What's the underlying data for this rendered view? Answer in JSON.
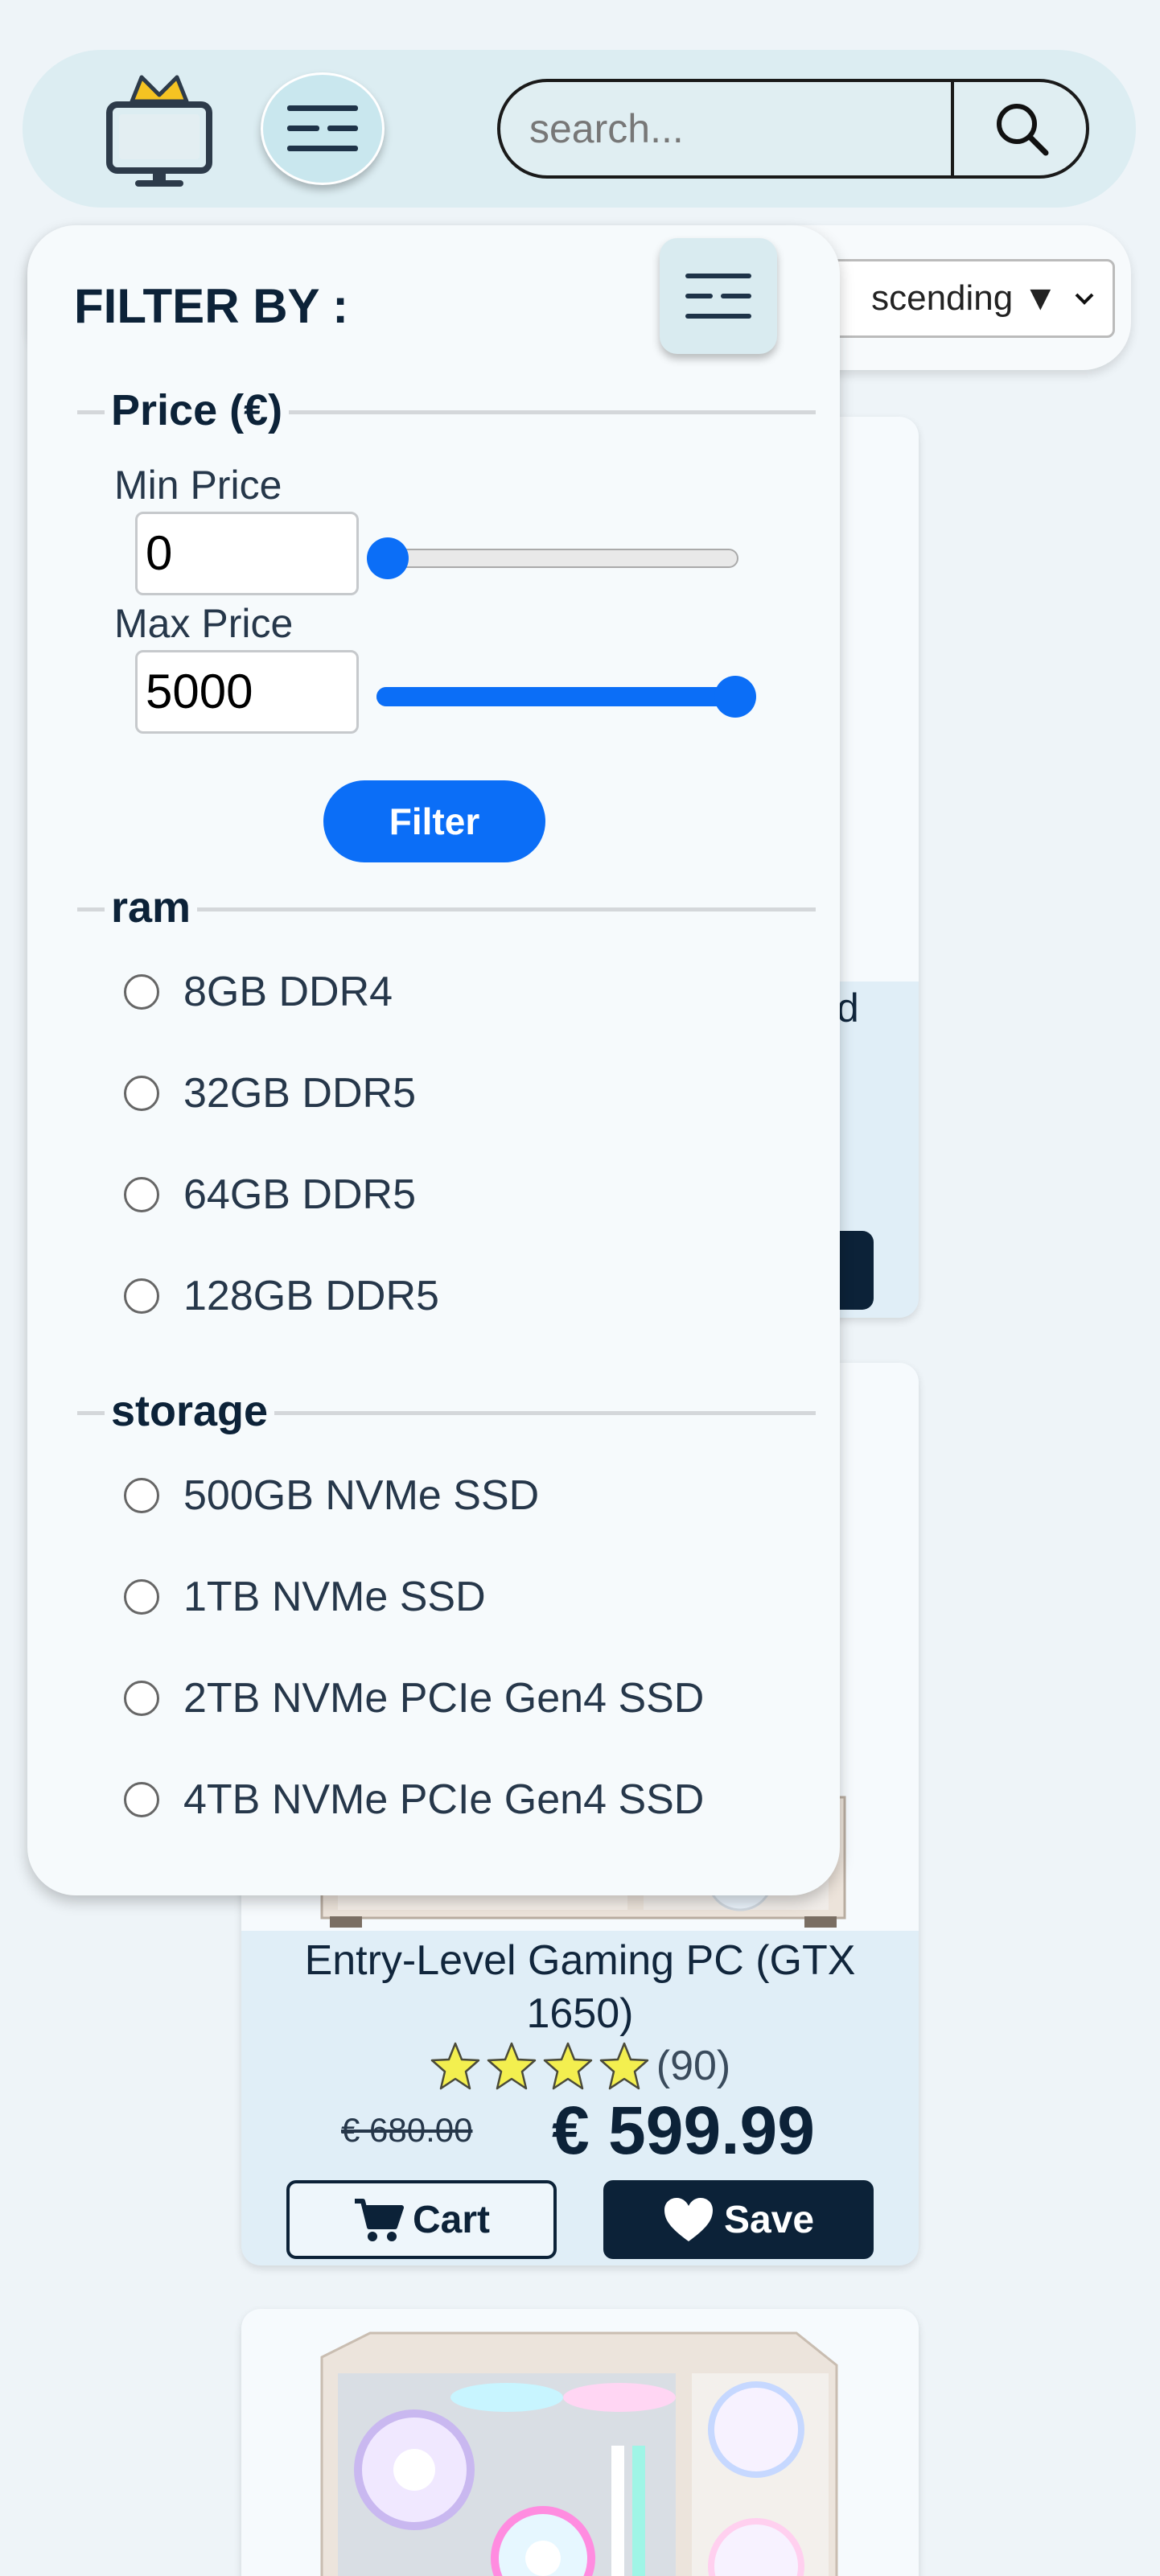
{
  "header": {
    "logo_icon": "monitor-crown-icon",
    "menu_icon": "menu-lines-icon",
    "search": {
      "placeholder": "search...",
      "value": "",
      "icon": "search-icon"
    }
  },
  "sort": {
    "visible_text": "scending ▼"
  },
  "filter": {
    "title": "FILTER BY :",
    "toggle_icon": "menu-lines-icon",
    "price": {
      "legend": "Price (€)",
      "min_label": "Min Price",
      "min_value": "0",
      "max_label": "Max Price",
      "max_value": "5000",
      "min_slider_fraction": 0,
      "max_slider_fraction": 1,
      "button_label": "Filter"
    },
    "ram": {
      "legend": "ram",
      "options": [
        "8GB DDR4",
        "32GB DDR5",
        "64GB DDR5",
        "128GB DDR5"
      ]
    },
    "storage": {
      "legend": "storage",
      "options": [
        "500GB NVMe SSD",
        "1TB NVMe SSD",
        "2TB NVMe PCIe Gen4 SSD",
        "4TB NVMe PCIe Gen4 SSD"
      ]
    }
  },
  "products": [
    {
      "title_fragment": "d"
    },
    {
      "title": "Entry-Level Gaming PC (GTX 1650)",
      "rating_stars": 4,
      "rating_count": "(90)",
      "old_price": "€ 680.00",
      "price": "€ 599.99",
      "cart_label": "Cart",
      "save_label": "Save"
    }
  ],
  "colors": {
    "accent": "#0b6ef7",
    "navy": "#0c2238",
    "header_bg": "#dcedf2",
    "star": "#f3ef4f"
  }
}
